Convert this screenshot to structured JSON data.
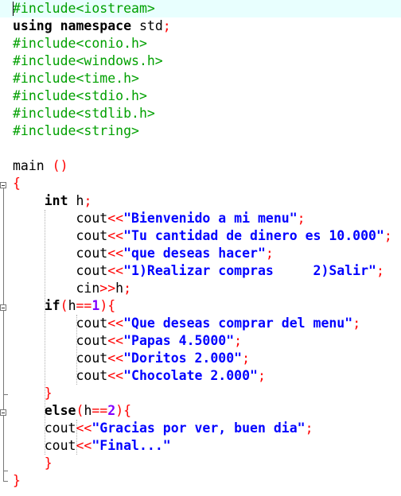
{
  "editor": {
    "lines": [
      [
        {
          "t": "#include<iostream>",
          "c": "pp"
        }
      ],
      [
        {
          "t": "using namespace",
          "c": "kw"
        },
        {
          "t": " std",
          "c": "tx"
        },
        {
          "t": ";",
          "c": "sym"
        }
      ],
      [
        {
          "t": "#include<conio.h>",
          "c": "pp"
        }
      ],
      [
        {
          "t": "#include<windows.h>",
          "c": "pp"
        }
      ],
      [
        {
          "t": "#include<time.h>",
          "c": "pp"
        }
      ],
      [
        {
          "t": "#include<stdio.h>",
          "c": "pp"
        }
      ],
      [
        {
          "t": "#include<stdlib.h>",
          "c": "pp"
        }
      ],
      [
        {
          "t": "#include<string>",
          "c": "pp"
        }
      ],
      [],
      [
        {
          "t": "main ",
          "c": "tx"
        },
        {
          "t": "()",
          "c": "sym"
        }
      ],
      [
        {
          "t": "{",
          "c": "sym"
        }
      ],
      [
        {
          "t": "    "
        },
        {
          "t": "int",
          "c": "kw"
        },
        {
          "t": " h",
          "c": "tx"
        },
        {
          "t": ";",
          "c": "sym"
        }
      ],
      [
        {
          "t": "        cout",
          "c": "tx"
        },
        {
          "t": "<<",
          "c": "sym"
        },
        {
          "t": "\"Bienvenido a mi menu\"",
          "c": "str"
        },
        {
          "t": ";",
          "c": "sym"
        }
      ],
      [
        {
          "t": "        cout",
          "c": "tx"
        },
        {
          "t": "<<",
          "c": "sym"
        },
        {
          "t": "\"Tu cantidad de dinero es 10.000\"",
          "c": "str"
        },
        {
          "t": ";",
          "c": "sym"
        }
      ],
      [
        {
          "t": "        cout",
          "c": "tx"
        },
        {
          "t": "<<",
          "c": "sym"
        },
        {
          "t": "\"que deseas hacer\"",
          "c": "str"
        },
        {
          "t": ";",
          "c": "sym"
        }
      ],
      [
        {
          "t": "        cout",
          "c": "tx"
        },
        {
          "t": "<<",
          "c": "sym"
        },
        {
          "t": "\"1)Realizar compras     2)Salir\"",
          "c": "str"
        },
        {
          "t": ";",
          "c": "sym"
        }
      ],
      [
        {
          "t": "        cin",
          "c": "tx"
        },
        {
          "t": ">>",
          "c": "sym"
        },
        {
          "t": "h",
          "c": "tx"
        },
        {
          "t": ";",
          "c": "sym"
        }
      ],
      [
        {
          "t": "    "
        },
        {
          "t": "if",
          "c": "kw"
        },
        {
          "t": "(",
          "c": "sym"
        },
        {
          "t": "h",
          "c": "tx"
        },
        {
          "t": "==",
          "c": "sym"
        },
        {
          "t": "1",
          "c": "num"
        },
        {
          "t": "){",
          "c": "sym"
        }
      ],
      [
        {
          "t": "        cout",
          "c": "tx"
        },
        {
          "t": "<<",
          "c": "sym"
        },
        {
          "t": "\"Que deseas comprar del menu\"",
          "c": "str"
        },
        {
          "t": ";",
          "c": "sym"
        }
      ],
      [
        {
          "t": "        cout",
          "c": "tx"
        },
        {
          "t": "<<",
          "c": "sym"
        },
        {
          "t": "\"Papas 4.5000\"",
          "c": "str"
        },
        {
          "t": ";",
          "c": "sym"
        }
      ],
      [
        {
          "t": "        cout",
          "c": "tx"
        },
        {
          "t": "<<",
          "c": "sym"
        },
        {
          "t": "\"Doritos 2.000\"",
          "c": "str"
        },
        {
          "t": ";",
          "c": "sym"
        }
      ],
      [
        {
          "t": "        cout",
          "c": "tx"
        },
        {
          "t": "<<",
          "c": "sym"
        },
        {
          "t": "\"Chocolate 2.000\"",
          "c": "str"
        },
        {
          "t": ";",
          "c": "sym"
        }
      ],
      [
        {
          "t": "    "
        },
        {
          "t": "}",
          "c": "sym"
        }
      ],
      [
        {
          "t": "    "
        },
        {
          "t": "else",
          "c": "kw"
        },
        {
          "t": "(",
          "c": "sym"
        },
        {
          "t": "h",
          "c": "tx"
        },
        {
          "t": "==",
          "c": "sym"
        },
        {
          "t": "2",
          "c": "num"
        },
        {
          "t": "){",
          "c": "sym"
        }
      ],
      [
        {
          "t": "    cout",
          "c": "tx"
        },
        {
          "t": "<<",
          "c": "sym"
        },
        {
          "t": "\"Gracias por ver, buen dia\"",
          "c": "str"
        },
        {
          "t": ";",
          "c": "sym"
        }
      ],
      [
        {
          "t": "    cout",
          "c": "tx"
        },
        {
          "t": "<<",
          "c": "sym"
        },
        {
          "t": "\"Final...\"",
          "c": "str"
        }
      ],
      [
        {
          "t": "    "
        },
        {
          "t": "}",
          "c": "sym"
        }
      ],
      [
        {
          "t": "}",
          "c": "sym"
        }
      ]
    ]
  },
  "colors": {
    "preprocessor": "#00a000",
    "keyword": "#000000",
    "symbol": "#ff0000",
    "string": "#0000ff",
    "number": "#8000ff",
    "current_line_bg": "#e8fffe"
  }
}
